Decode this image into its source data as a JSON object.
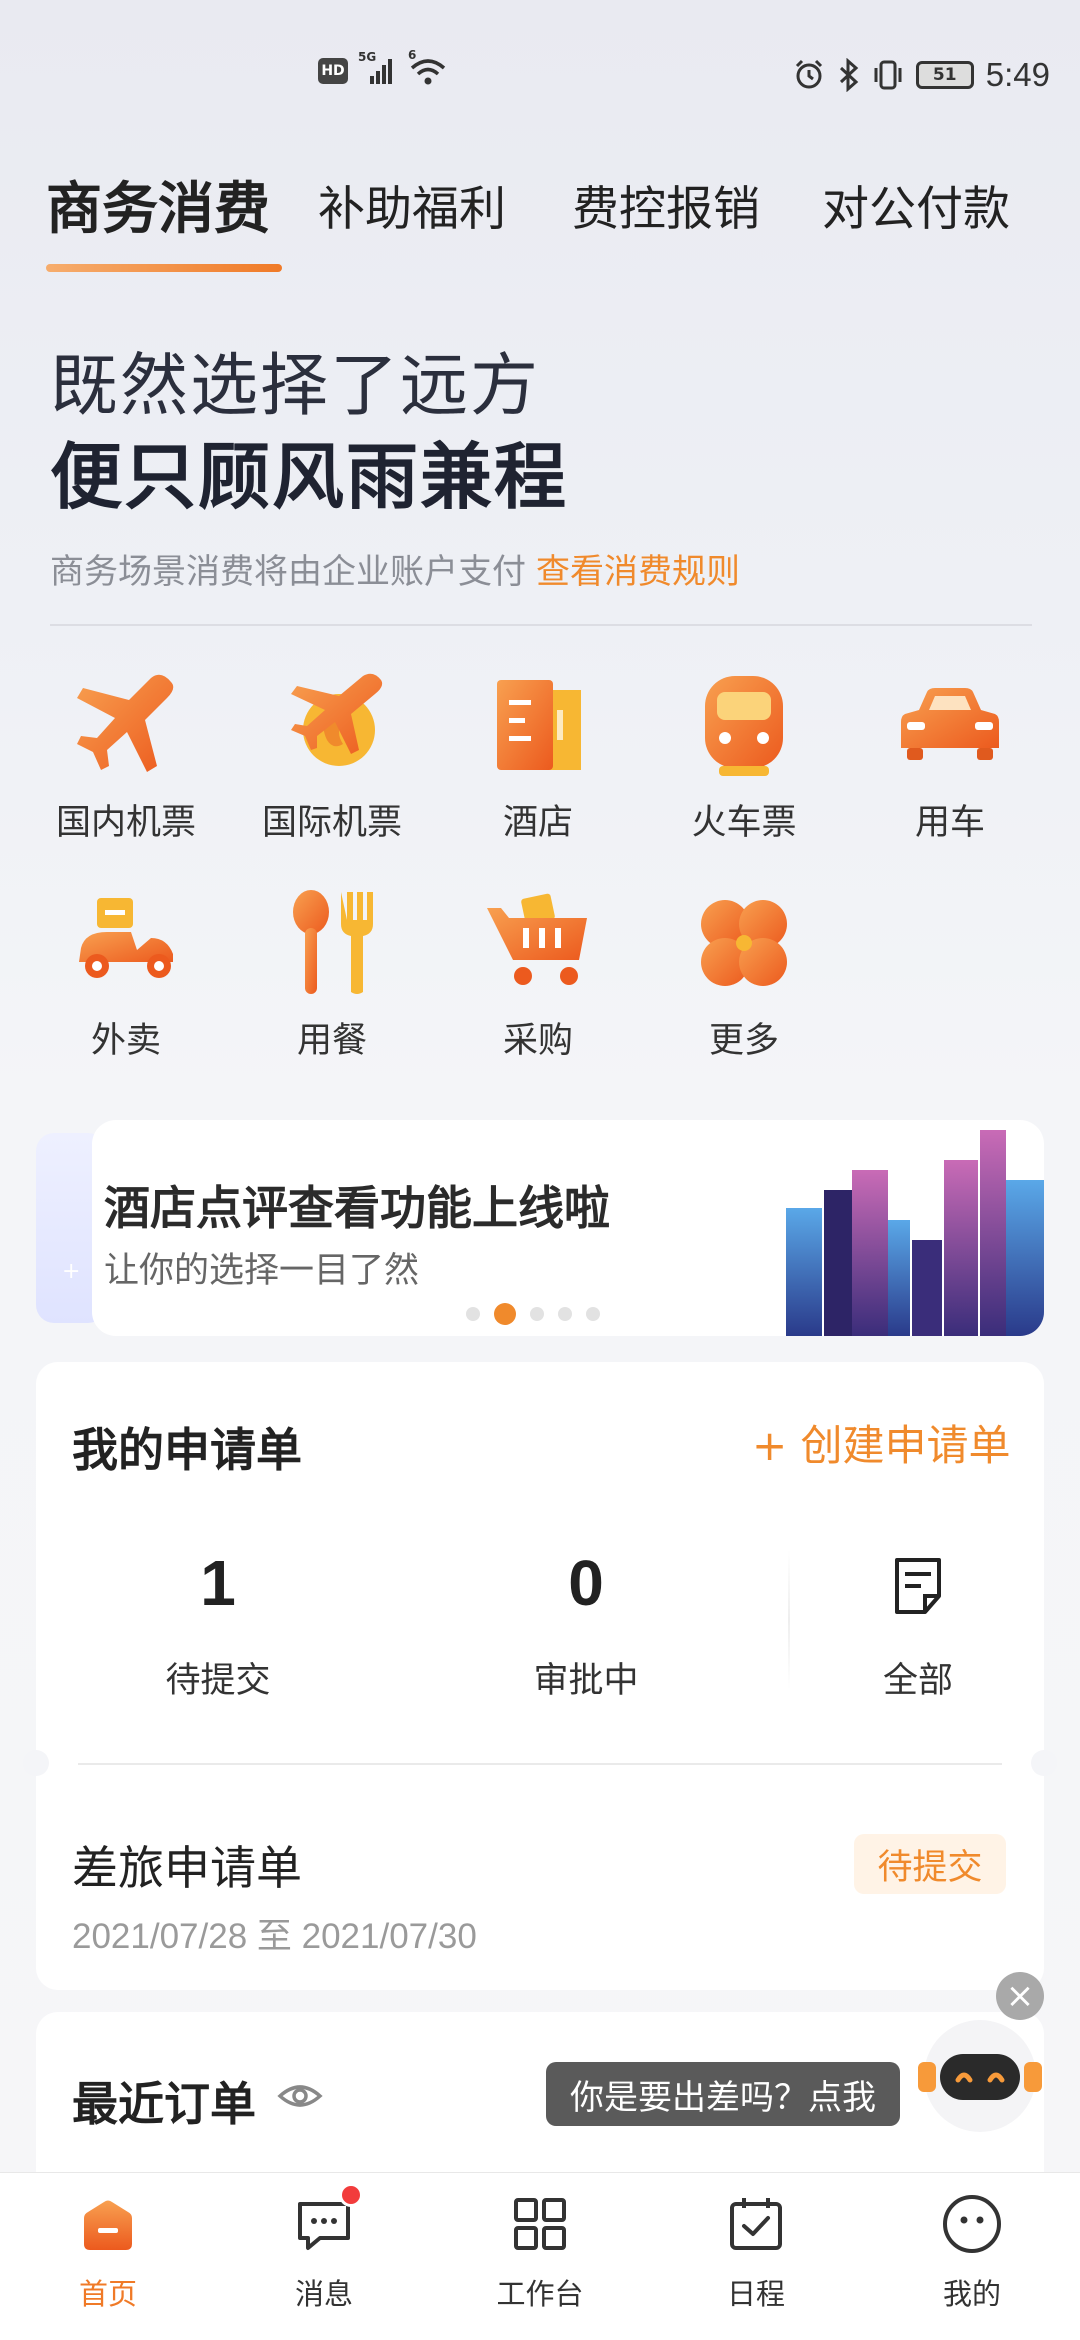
{
  "status_bar": {
    "hd": "HD",
    "network": "5G",
    "wifi_gen": "6",
    "battery": "51",
    "time": "5:49"
  },
  "tabs": [
    {
      "label": "商务消费",
      "active": true
    },
    {
      "label": "补助福利",
      "active": false
    },
    {
      "label": "费控报销",
      "active": false
    },
    {
      "label": "对公付款",
      "active": false
    }
  ],
  "hero": {
    "line1": "既然选择了远方",
    "line2": "便只顾风雨兼程"
  },
  "notice": {
    "text": "商务场景消费将由企业账户支付",
    "link": "查看消费规则"
  },
  "services": [
    {
      "label": "国内机票",
      "icon": "plane-icon"
    },
    {
      "label": "国际机票",
      "icon": "globe-plane-icon"
    },
    {
      "label": "酒店",
      "icon": "hotel-icon"
    },
    {
      "label": "火车票",
      "icon": "train-icon"
    },
    {
      "label": "用车",
      "icon": "car-icon"
    },
    {
      "label": "外卖",
      "icon": "scooter-icon"
    },
    {
      "label": "用餐",
      "icon": "cutlery-icon"
    },
    {
      "label": "采购",
      "icon": "cart-icon"
    },
    {
      "label": "更多",
      "icon": "more-icon"
    }
  ],
  "banner": {
    "title": "酒店点评查看功能上线啦",
    "subtitle": "让你的选择一目了然",
    "slide_count": 5,
    "active_slide": 2
  },
  "applications": {
    "title": "我的申请单",
    "create_label": "+ 创建申请单",
    "pending": {
      "count": "1",
      "label": "待提交"
    },
    "approving": {
      "count": "0",
      "label": "审批中"
    },
    "all_label": "全部"
  },
  "trip": {
    "title": "差旅申请单",
    "dates": "2021/07/28 至 2021/07/30",
    "status": "待提交"
  },
  "recent": {
    "title": "最近订单",
    "tooltip": "你是要出差吗？点我",
    "close": "×"
  },
  "bottom_nav": [
    {
      "label": "首页",
      "icon": "home-icon",
      "active": true
    },
    {
      "label": "消息",
      "icon": "message-icon",
      "active": false,
      "unread": true
    },
    {
      "label": "工作台",
      "icon": "grid-icon",
      "active": false
    },
    {
      "label": "日程",
      "icon": "calendar-icon",
      "active": false
    },
    {
      "label": "我的",
      "icon": "profile-icon",
      "active": false
    }
  ],
  "colors": {
    "accent": "#f07a27",
    "accent_light": "#f6ad6d",
    "text_dark": "#222222",
    "text_gray": "#8b8e96"
  }
}
